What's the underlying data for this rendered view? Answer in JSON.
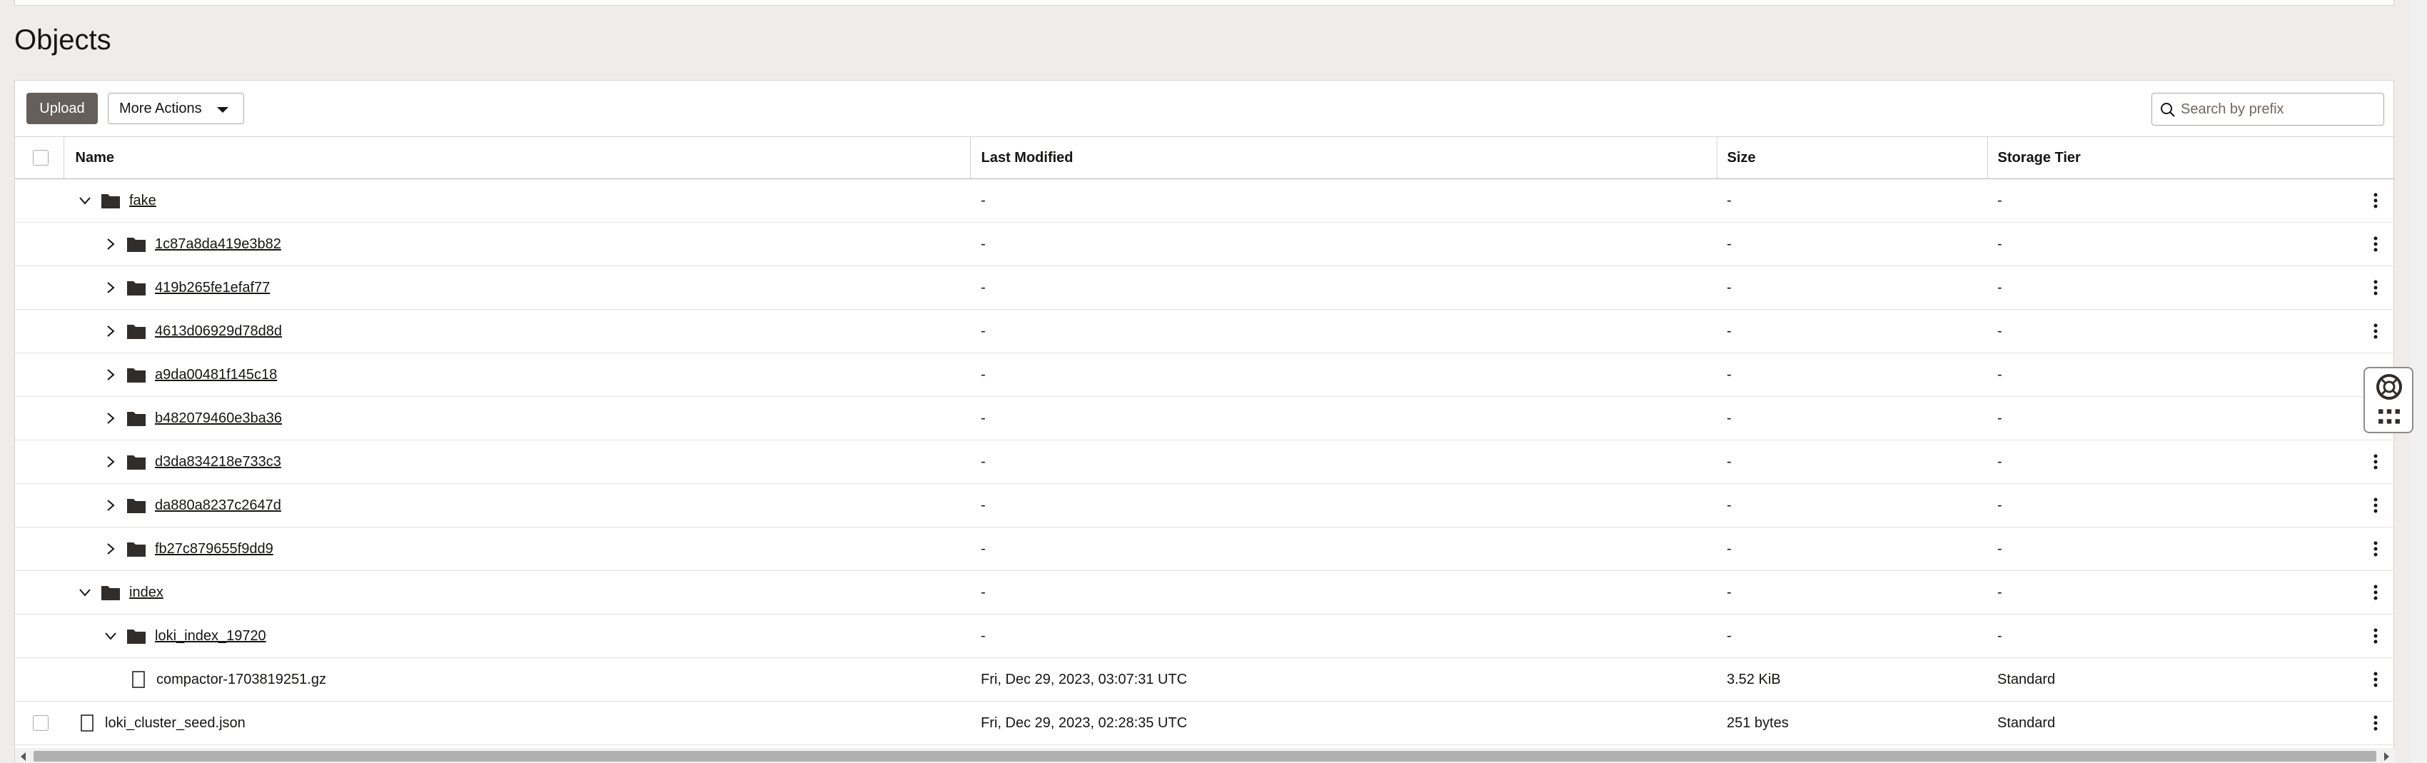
{
  "page": {
    "title": "Objects"
  },
  "toolbar": {
    "upload_label": "Upload",
    "more_actions_label": "More Actions",
    "search_placeholder": "Search by prefix"
  },
  "table": {
    "columns": [
      "Name",
      "Last Modified",
      "Size",
      "Storage Tier"
    ],
    "rows": [
      {
        "name": "fake",
        "modified": "-",
        "size": "-",
        "tier": "-"
      },
      {
        "name": "1c87a8da419e3b82",
        "modified": "-",
        "size": "-",
        "tier": "-"
      },
      {
        "name": "419b265fe1efaf77",
        "modified": "-",
        "size": "-",
        "tier": "-"
      },
      {
        "name": "4613d06929d78d8d",
        "modified": "-",
        "size": "-",
        "tier": "-"
      },
      {
        "name": "a9da00481f145c18",
        "modified": "-",
        "size": "-",
        "tier": "-"
      },
      {
        "name": "b482079460e3ba36",
        "modified": "-",
        "size": "-",
        "tier": "-"
      },
      {
        "name": "d3da834218e733c3",
        "modified": "-",
        "size": "-",
        "tier": "-"
      },
      {
        "name": "da880a8237c2647d",
        "modified": "-",
        "size": "-",
        "tier": "-"
      },
      {
        "name": "fb27c879655f9dd9",
        "modified": "-",
        "size": "-",
        "tier": "-"
      },
      {
        "name": "index",
        "modified": "-",
        "size": "-",
        "tier": "-"
      },
      {
        "name": "loki_index_19720",
        "modified": "-",
        "size": "-",
        "tier": "-"
      },
      {
        "name": "compactor-1703819251.gz",
        "modified": "Fri, Dec 29, 2023, 03:07:31 UTC",
        "size": "3.52 KiB",
        "tier": "Standard"
      },
      {
        "name": "loki_cluster_seed.json",
        "modified": "Fri, Dec 29, 2023, 02:28:35 UTC",
        "size": "251 bytes",
        "tier": "Standard"
      }
    ]
  },
  "colors": {
    "upload_bg": "#655f5b",
    "page_bg": "#eeedeb",
    "text": "#161513"
  }
}
